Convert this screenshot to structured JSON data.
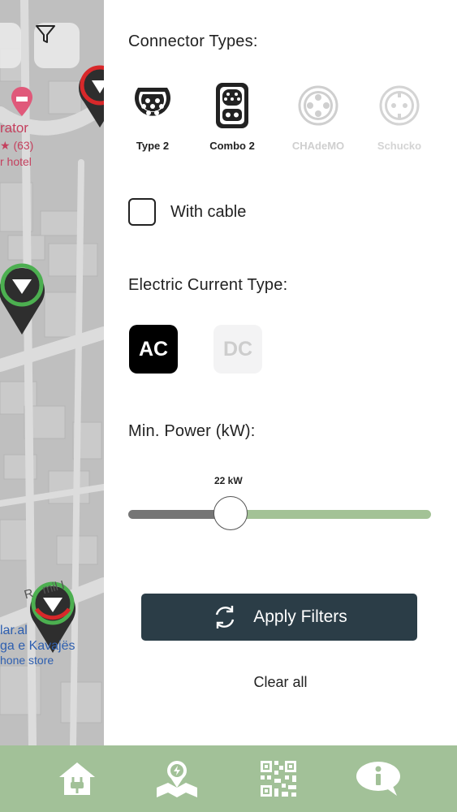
{
  "map": {
    "poi_partial_name": "rator",
    "poi_rating": "★ (63)",
    "poi_category": "r hotel",
    "street_partial": "R   mil I",
    "store_name_partial": "lar.al",
    "store_subtitle_partial": "ga e Kavajës",
    "store_category": "hone store"
  },
  "filters": {
    "connector_title": "Connector Types:",
    "connectors": [
      {
        "label": "Type 2",
        "selected": true,
        "icon": "type2-connector-icon"
      },
      {
        "label": "Combo 2",
        "selected": true,
        "icon": "combo2-connector-icon"
      },
      {
        "label": "CHAdeMO",
        "selected": false,
        "icon": "chademo-connector-icon"
      },
      {
        "label": "Schucko",
        "selected": false,
        "icon": "schuko-connector-icon"
      }
    ],
    "cable_label": "With cable",
    "cable_checked": false,
    "current_title": "Electric Current Type:",
    "current_types": [
      {
        "label": "AC",
        "selected": true
      },
      {
        "label": "DC",
        "selected": false
      }
    ],
    "power_title": "Min. Power (kW):",
    "power_value_label": "22 kW",
    "apply_label": "Apply Filters",
    "clear_label": "Clear all"
  },
  "colors": {
    "dark_button": "#2b3d47",
    "nav_bg": "#a2c198",
    "slider_active": "#a3c296",
    "selected_current": "#000000"
  },
  "nav": {
    "items": [
      "home-charger-icon",
      "map-location-icon",
      "qr-code-icon",
      "info-chat-icon"
    ],
    "active_index": 1
  }
}
